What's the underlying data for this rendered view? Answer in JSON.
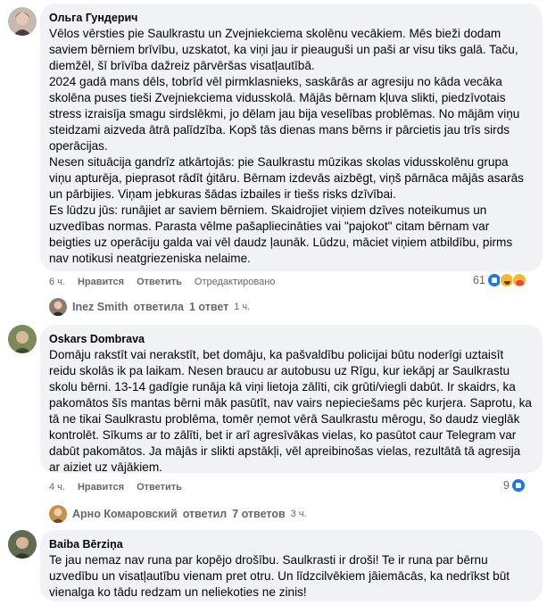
{
  "comments": [
    {
      "author": "Ольга Гундерич",
      "paragraphs": [
        "Vēlos vērsties pie Saulkrastu un Zvejniekciema skolēnu vecākiem. Mēs bieži dodam saviem bērniem brīvību, uzskatot, ka viņi jau ir pieauguši un paši ar visu tiks galā. Taču, diemžēl, šī brīvība dažreiz pārvēršas visatļautībā.",
        "2024 gadā mans dēls, tobrīd vēl pirmklasnieks, saskārās ar agresiju no kāda vecāka skolēna puses tieši Zvejniekciema vidusskolā. Mājās bērnam kļuva slikti, piedzīvotais stress izraisīja smagu sirdslēkmi, jo dēlam jau bija veselības problēmas. No mājām viņu steidzami aizveda ātrā palīdzība. Kopš tās dienas mans bērns ir pārcietis jau trīs sirds operācijas.",
        "Nesen situācija gandrīz atkārtojās: pie Saulkrastu mūzikas skolas vidusskolēnu grupa viņu apturēja, pieprasot rādīt ģitāru. Bērnam izdevās aizbēgt, viņš pārnāca mājās asarās un pārbijies. Viņam jebkuras šādas izbailes ir tiešs risks dzīvībai.",
        "Es lūdzu jūs: runājiet ar saviem bērniem. Skaidrojiet viņiem dzīves noteikumus un uzvedības normas. Parasta vēlme pašapliecināties vai \"pajokot\" citam bērnam var beigties uz operāciju galda vai vēl daudz ļaunāk. Lūdzu, māciet viņiem atbildību, pirms nav notikusi neatgriezeniska nelaime."
      ],
      "time": "6 ч.",
      "like": "Нравится",
      "reply": "Ответить",
      "extra": "Отредактировано",
      "reaction_count": "61",
      "reactions": [
        "like",
        "haha",
        "care"
      ],
      "replies": {
        "author": "Inez Smith",
        "action": "ответила",
        "count": "1 ответ",
        "time": "1 ч."
      }
    },
    {
      "author": "Oskars Dombrava",
      "paragraphs": [
        "Domāju rakstīt vai nerakstīt, bet domāju, ka pašvaldību policijai būtu noderīgi uztaisīt reidu skolās ik pa laikam. Nesen braucu ar autobusu uz Rīgu, kur iekāpj ar Saulkrastu skolu bērni. 13-14 gadīgie runāja kā viņi lietoja zālīti, cik grūti/viegli dabūt. Ir skaidrs, ka pakomātos šīs mantas bērni māk pasūtīt, nav vairs nepieciešams pēc kurjera. Saprotu, ka tā ne tikai Saulkrastu problēma, tomēr ņemot vērā Saulkrastu mērogu, šo daudz vieglāk kontrolēt. Sīkums ar to zālīti, bet ir arī agresīvākas vielas, ko pasūtot caur Telegram var dabūt pakomātos. Ja mājās ir slikti apstākļi, vēl apreibinošas vielas, rezultātā tā agresija ar aiziet uz vājākiem."
      ],
      "time": "4 ч.",
      "like": "Нравится",
      "reply": "Ответить",
      "reaction_count": "9",
      "reactions": [
        "like"
      ],
      "replies": {
        "author": "Арно Комаровский",
        "action": "ответил",
        "count": "7 ответов",
        "time": "3 ч."
      }
    },
    {
      "author": "Baiba Bērziņa",
      "paragraphs": [
        "Te jau nemaz nav runa par kopējo drošību. Saulkrasti ir droši! Te ir runa par bērnu uzvedību un visatļautību vienam pret otru. Un līdzcilvēkiem jāiemācās, ka nedrīkst būt vienalga ko tādu redzam un neliekoties ne zinis!"
      ]
    }
  ],
  "colors": {
    "bubble": "#f0f2f5",
    "meta": "#65676b",
    "like_blue": "#1877f2"
  }
}
